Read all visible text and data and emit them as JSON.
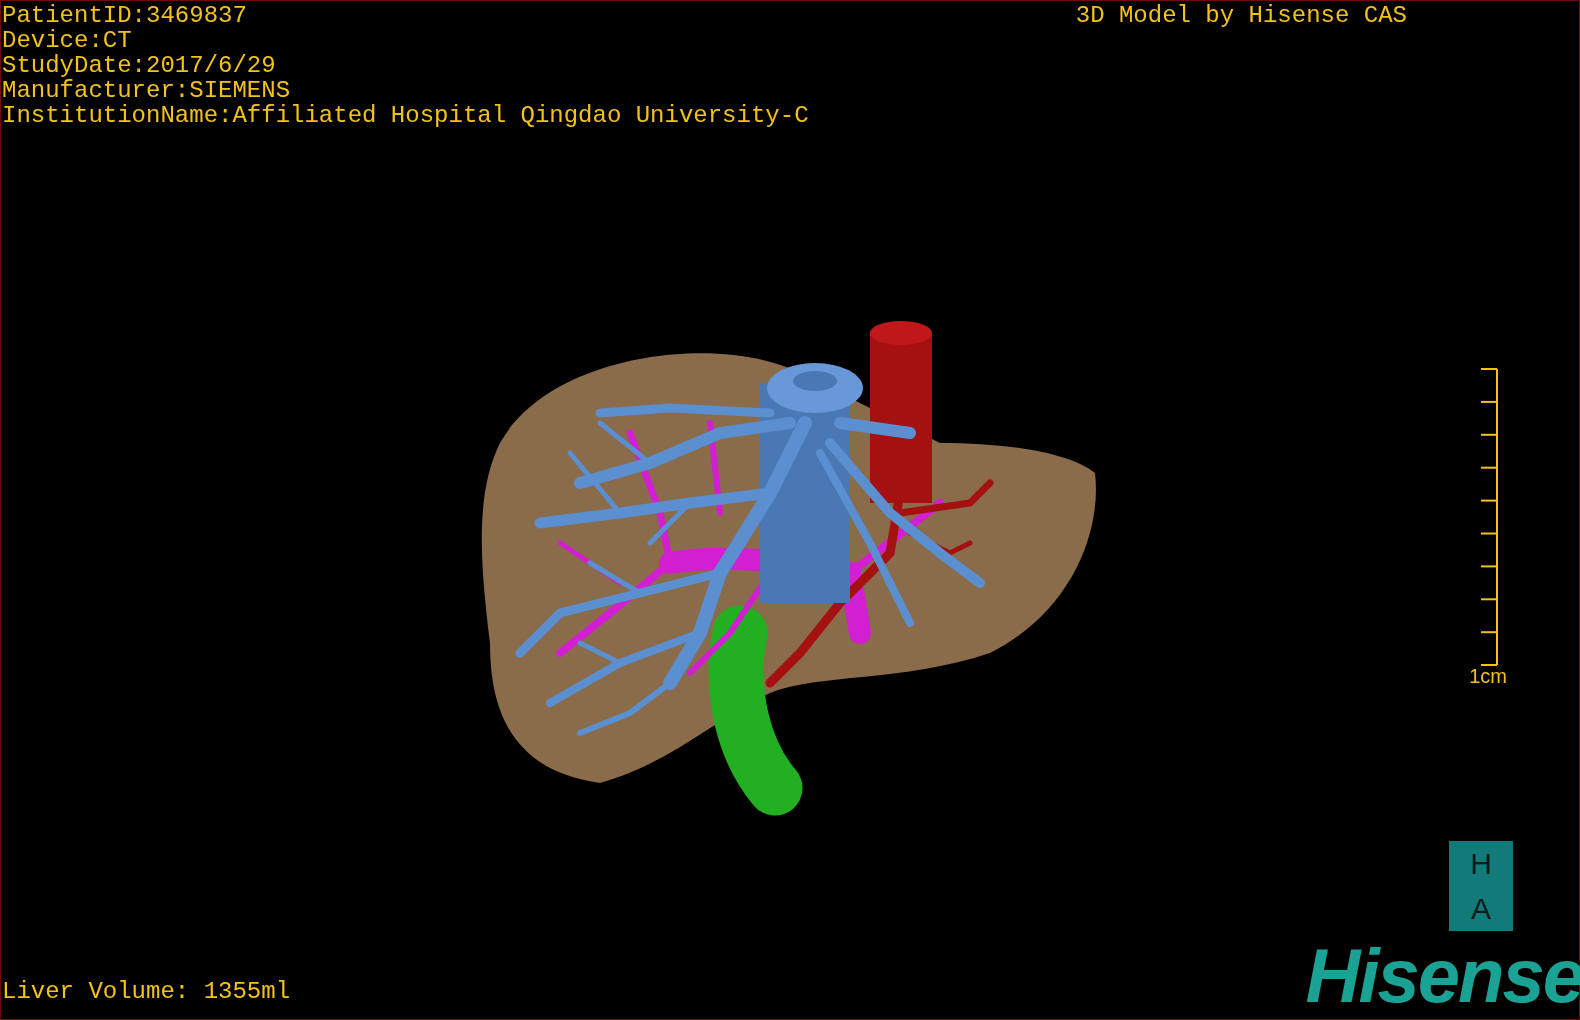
{
  "info_lines": [
    "PatientID:3469837",
    "Device:CT",
    "StudyDate:2017/6/29",
    "Manufacturer:SIEMENS",
    "InstitutionName:Affiliated Hospital Qingdao University-C"
  ],
  "title": "3D Model by Hisense CAS",
  "scale_bar": {
    "label": "1cm"
  },
  "liver_volume": "Liver Volume: 1355ml",
  "orientation_cube": {
    "top": "H",
    "bottom": "A"
  },
  "logo": "Hisense"
}
